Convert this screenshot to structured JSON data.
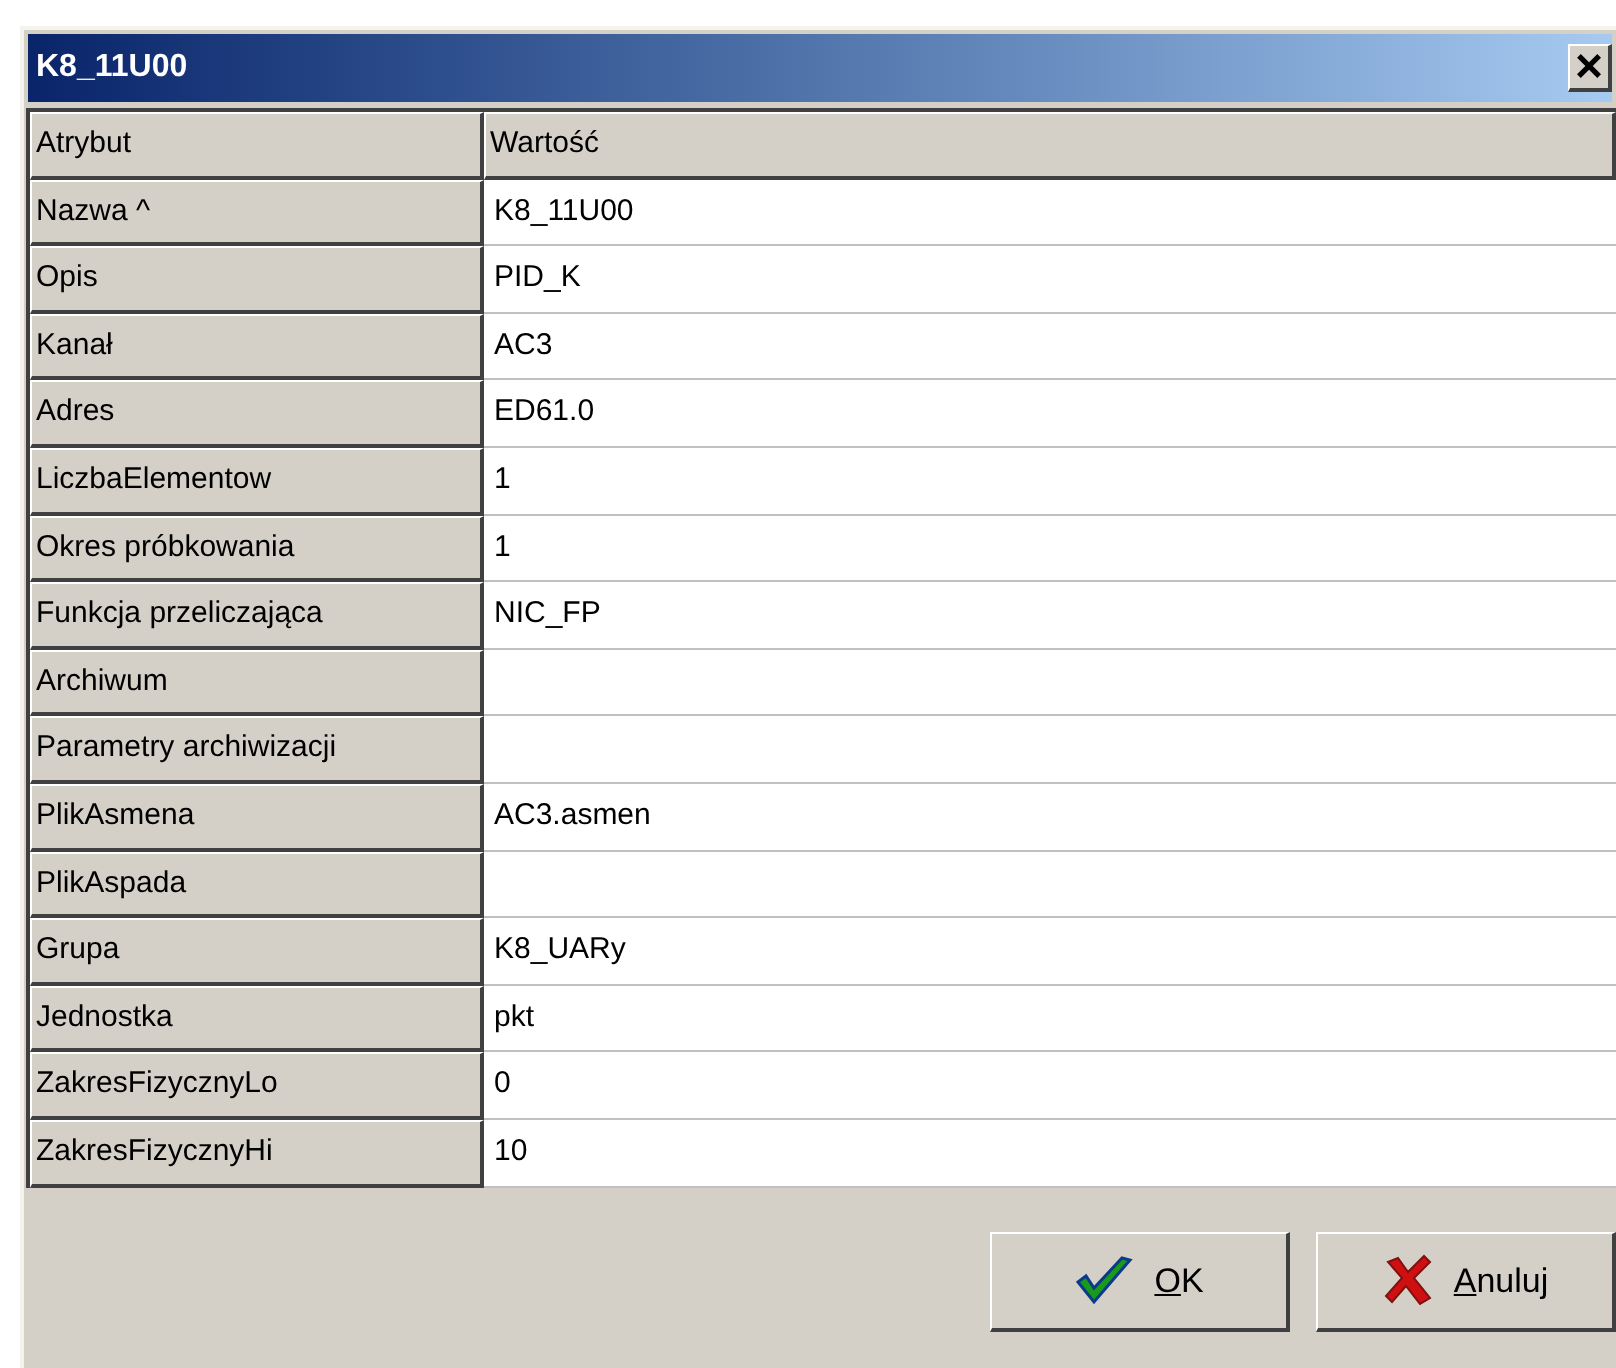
{
  "window": {
    "title": "K8_11U00",
    "close": "×"
  },
  "table": {
    "columns": [
      "Atrybut",
      "Wartość"
    ],
    "rows": [
      {
        "attribute": "Nazwa ^",
        "value": "K8_11U00"
      },
      {
        "attribute": "Opis",
        "value": "PID_K"
      },
      {
        "attribute": "Kanał",
        "value": "AC3"
      },
      {
        "attribute": "Adres",
        "value": "ED61.0"
      },
      {
        "attribute": "LiczbaElementow",
        "value": "1"
      },
      {
        "attribute": "Okres próbkowania",
        "value": "1"
      },
      {
        "attribute": "Funkcja przeliczająca",
        "value": "NIC_FP"
      },
      {
        "attribute": "Archiwum"
      },
      {
        "attribute": "Parametry archiwizacji"
      },
      {
        "attribute": "PlikAsmena",
        "value": "AC3.asmen"
      },
      {
        "attribute": "PlikAspada"
      },
      {
        "attribute": "Grupa",
        "value": "K8_UARy"
      },
      {
        "attribute": "Jednostka",
        "value": "pkt"
      },
      {
        "attribute": "ZakresFizycznyLo",
        "value": "0"
      },
      {
        "attribute": "ZakresFizycznyHi",
        "value": "10"
      }
    ]
  },
  "buttons": [
    {
      "kind": "ok",
      "label": "OK",
      "mnemonic_first": true
    },
    {
      "kind": "cancel",
      "label": "Anuluj",
      "mnemonic_first": true
    }
  ]
}
